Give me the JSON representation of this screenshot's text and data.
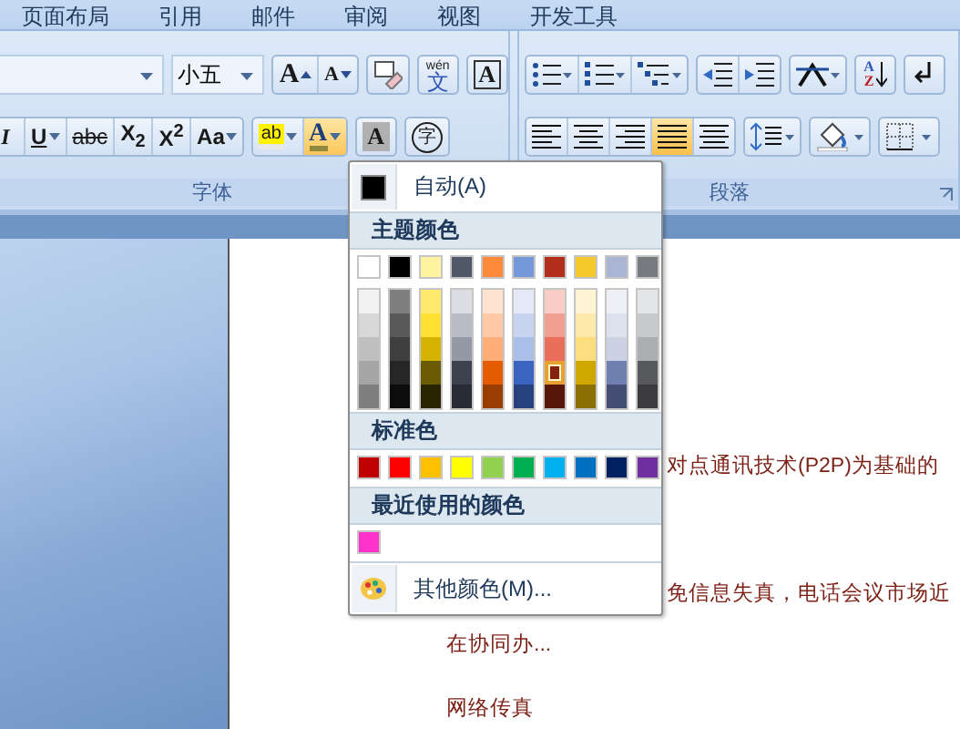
{
  "tabs": [
    {
      "label": "页面布局",
      "selected": false
    },
    {
      "label": "引用",
      "selected": false
    },
    {
      "label": "邮件",
      "selected": false
    },
    {
      "label": "审阅",
      "selected": false
    },
    {
      "label": "视图",
      "selected": false
    },
    {
      "label": "开发工具",
      "selected": false
    }
  ],
  "font_group": {
    "label": "字体",
    "font_size": "小五",
    "grow": "A",
    "shrink": "A",
    "phonetic_top": "wén",
    "phonetic_char": "文",
    "char_border": "A",
    "format_buttons": [
      {
        "text": "I",
        "dropdown": false
      },
      {
        "text": "U",
        "dropdown": true
      },
      {
        "text": "abc",
        "dropdown": false
      },
      {
        "text": "X$_{2}$",
        "dropdown": false
      },
      {
        "text": "X$^{2}$",
        "dropdown": false
      },
      {
        "text": "Aa",
        "dropdown": true
      }
    ],
    "highlight": "ab",
    "font_color": {
      "text": "A",
      "pressed": true
    },
    "char_shading": "A",
    "enclose": "字"
  },
  "paragraph_group": {
    "label": "段落",
    "sort_top": "A",
    "sort_bottom": "Z",
    "align_buttons": [
      {
        "selected": false
      },
      {
        "selected": false
      },
      {
        "selected": false
      },
      {
        "selected": true
      },
      {
        "selected": false
      }
    ]
  },
  "color_menu": {
    "auto": "自动(A)",
    "theme_header": "主题颜色",
    "theme_colors": [
      {
        "color": "#ffffff",
        "shades": [
          {
            "color": "#f2f2f2",
            "selected": false
          },
          {
            "color": "#d8d8d8",
            "selected": false
          },
          {
            "color": "#bfbfbf",
            "selected": false
          },
          {
            "color": "#a5a5a5",
            "selected": false
          },
          {
            "color": "#7f7f7f",
            "selected": false
          }
        ]
      },
      {
        "color": "#000000",
        "shades": [
          {
            "color": "#7f7f7f",
            "selected": false
          },
          {
            "color": "#595959",
            "selected": false
          },
          {
            "color": "#3f3f3f",
            "selected": false
          },
          {
            "color": "#262626",
            "selected": false
          },
          {
            "color": "#0c0c0c",
            "selected": false
          }
        ]
      },
      {
        "color": "#fff2a0",
        "shades": [
          {
            "color": "#ffe96b",
            "selected": false
          },
          {
            "color": "#ffe033",
            "selected": false
          },
          {
            "color": "#d4b400",
            "selected": false
          },
          {
            "color": "#6a5a00",
            "selected": false
          },
          {
            "color": "#2a2400",
            "selected": false
          }
        ]
      },
      {
        "color": "#515868",
        "shades": [
          {
            "color": "#dcdde2",
            "selected": false
          },
          {
            "color": "#b9bcc5",
            "selected": false
          },
          {
            "color": "#9499a5",
            "selected": false
          },
          {
            "color": "#3d424e",
            "selected": false
          },
          {
            "color": "#292c34",
            "selected": false
          }
        ]
      },
      {
        "color": "#ff8a3a",
        "shades": [
          {
            "color": "#ffe2d0",
            "selected": false
          },
          {
            "color": "#ffc9a5",
            "selected": false
          },
          {
            "color": "#ffae77",
            "selected": false
          },
          {
            "color": "#e55b00",
            "selected": false
          },
          {
            "color": "#993d00",
            "selected": false
          }
        ]
      },
      {
        "color": "#7599d8",
        "shades": [
          {
            "color": "#e3e9f7",
            "selected": false
          },
          {
            "color": "#c8d4ef",
            "selected": false
          },
          {
            "color": "#aabfe7",
            "selected": false
          },
          {
            "color": "#3a64c0",
            "selected": false
          },
          {
            "color": "#25427f",
            "selected": false
          }
        ]
      },
      {
        "color": "#b22e1a",
        "shades": [
          {
            "color": "#f7cdc6",
            "selected": false
          },
          {
            "color": "#f19f90",
            "selected": false
          },
          {
            "color": "#ea6f5a",
            "selected": false
          },
          {
            "color": "#85220f",
            "selected": true
          },
          {
            "color": "#59160a",
            "selected": false
          }
        ]
      },
      {
        "color": "#f5c92b",
        "shades": [
          {
            "color": "#fef4d4",
            "selected": false
          },
          {
            "color": "#fde9aa",
            "selected": false
          },
          {
            "color": "#fcde7f",
            "selected": false
          },
          {
            "color": "#d0a700",
            "selected": false
          },
          {
            "color": "#8b6f00",
            "selected": false
          }
        ]
      },
      {
        "color": "#aab4d3",
        "shades": [
          {
            "color": "#eef0f6",
            "selected": false
          },
          {
            "color": "#dde1ed",
            "selected": false
          },
          {
            "color": "#ccd2e4",
            "selected": false
          },
          {
            "color": "#6f7faf",
            "selected": false
          },
          {
            "color": "#454f75",
            "selected": false
          }
        ]
      },
      {
        "color": "#777b80",
        "shades": [
          {
            "color": "#e3e4e5",
            "selected": false
          },
          {
            "color": "#c8c9cb",
            "selected": false
          },
          {
            "color": "#acaeb1",
            "selected": false
          },
          {
            "color": "#58595c",
            "selected": false
          },
          {
            "color": "#3b3b3d",
            "selected": false
          }
        ]
      }
    ],
    "standard_header": "标准色",
    "standard_colors": [
      {
        "color": "#c00000"
      },
      {
        "color": "#ff0000"
      },
      {
        "color": "#ffc000"
      },
      {
        "color": "#ffff00"
      },
      {
        "color": "#92d050"
      },
      {
        "color": "#00b050"
      },
      {
        "color": "#00b0f0"
      },
      {
        "color": "#0070c0"
      },
      {
        "color": "#002060"
      },
      {
        "color": "#7030a0"
      }
    ],
    "recent_header": "最近使用的颜色",
    "recent_colors": [
      {
        "color": "#ff33cc"
      }
    ],
    "more": "其他颜色(M)..."
  },
  "document": {
    "lines": [
      {
        "text": "对点通讯技术(P2P)为基础的"
      },
      {
        "text": "免信息失真，电话会议市场近"
      },
      {
        "text": "在协同办..."
      },
      {
        "text": "网络传真"
      }
    ]
  }
}
